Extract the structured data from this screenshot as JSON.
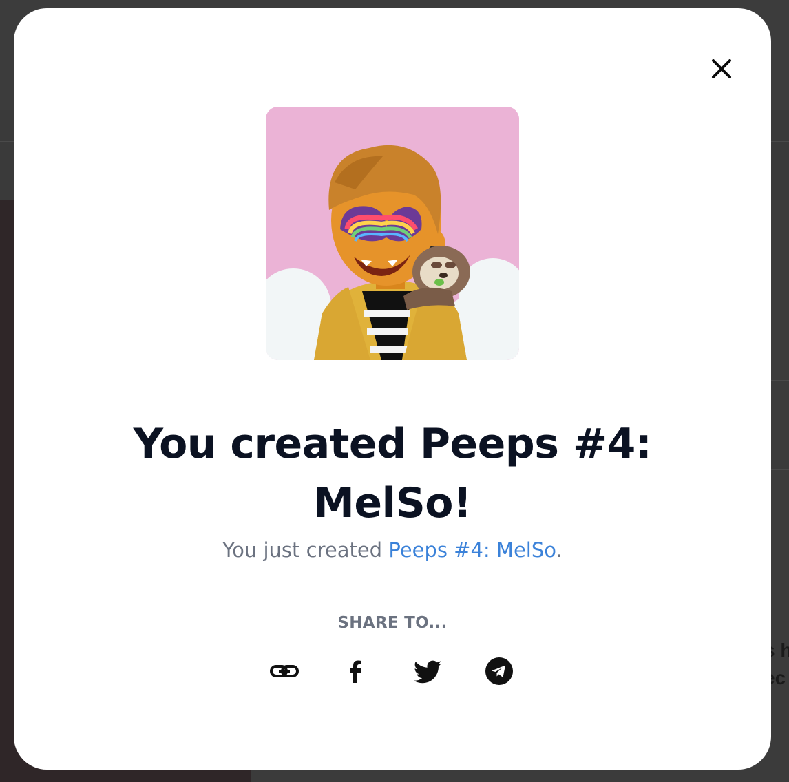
{
  "background": {
    "partial_text": "s h\nec"
  },
  "modal": {
    "title_line1": "You created Peeps #4:",
    "title_line2": "MelSo!",
    "subtitle_prefix": "You just created ",
    "subtitle_link": "Peeps #4: MelSo",
    "subtitle_suffix": ".",
    "share_label": "SHARE TO...",
    "close_icon": "close-icon",
    "share_icons": [
      "link-icon",
      "facebook-icon",
      "twitter-icon",
      "telegram-icon"
    ]
  },
  "colors": {
    "link": "#3b82d9",
    "title": "#0b1222",
    "muted": "#6b7280",
    "art_background": "#ebb3d6"
  }
}
